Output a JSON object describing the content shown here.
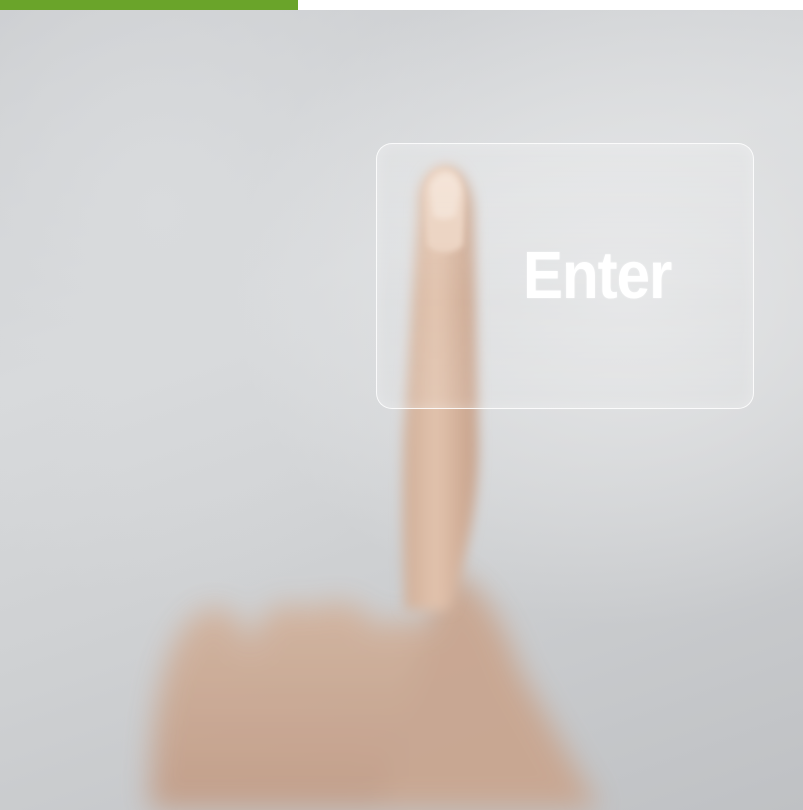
{
  "button": {
    "label": "Enter"
  },
  "colors": {
    "accent_bar": "#6aa42a",
    "background": "#d3d5d7",
    "skin": "#d9b9a3"
  },
  "icons": [
    "pointing-hand"
  ]
}
